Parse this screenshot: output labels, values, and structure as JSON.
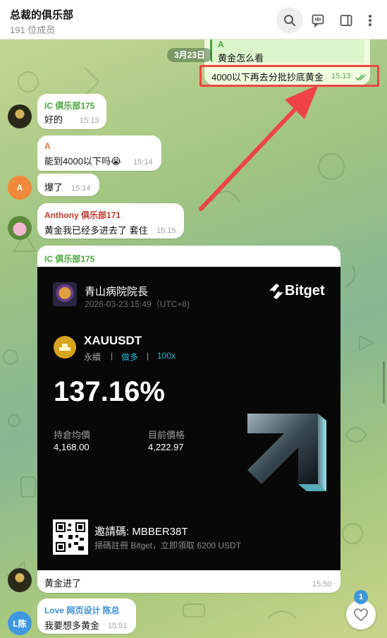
{
  "header": {
    "title": "总裁的俱乐部",
    "subtitle": "191 位成员"
  },
  "date_pill": "3月23日",
  "messages": [
    {
      "reply_sender": "A",
      "reply_text": "黄金怎么看",
      "text": "4000以下再去分批抄底黄金",
      "time": "15:13"
    },
    {
      "sender": "IC 俱乐部175",
      "text": "好的",
      "time": "15:13"
    },
    {
      "sender": "A",
      "text": "能到4000以下吗😭",
      "time": "15:14"
    },
    {
      "text": "爆了",
      "time": "15:14",
      "avatar": "A"
    },
    {
      "sender": "Anthony 俱乐部171",
      "text": "黄金我已经多进去了 套住",
      "time": "15:15"
    },
    {
      "sender": "IC 俱乐部175",
      "text": "黄金进了",
      "time": "15:50"
    },
    {
      "sender": "Love 网页设计 陈总",
      "text": "我要想多黄金",
      "time": "15:51",
      "avatar": "L陈"
    }
  ],
  "card": {
    "username": "青山病院院長",
    "datetime": "2026-03-23 15:49（UTC+8)",
    "brand": "Bitget",
    "symbol": "XAUUSDT",
    "contract": "永續",
    "direction": "做多",
    "leverage": "100x",
    "roi": "137.16%",
    "entry_label": "持倉均價",
    "entry_value": "4,168.00",
    "mark_label": "目前價格",
    "mark_value": "4,222.97",
    "invite": "邀請碼: MBBER38T",
    "promo": "掃碼註冊 Bitget，立即領取 6200 USDT"
  },
  "fab_badge": "1",
  "colors": {
    "green_name": "#4aa63d",
    "orange_name": "#e0752e",
    "red_name": "#c0392b",
    "blue_name": "#3a8fd6",
    "highlight": "#ef4444",
    "bitget_cyan": "#1bb8d6"
  }
}
